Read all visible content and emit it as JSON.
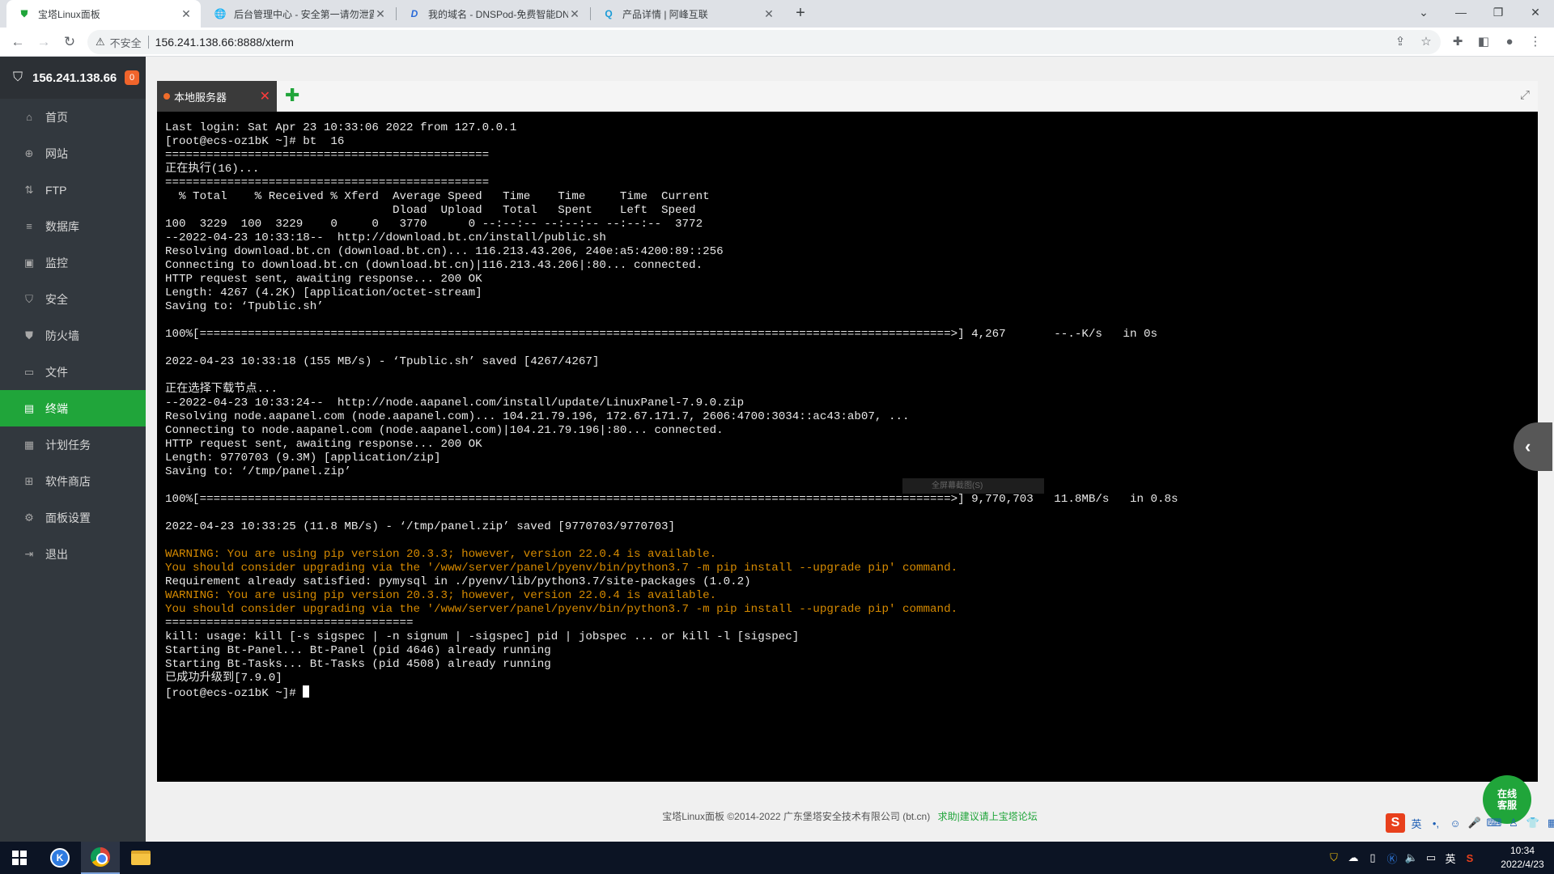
{
  "browser": {
    "tabs": [
      {
        "title": "宝塔Linux面板",
        "icon": "baota-shield-icon",
        "active": true
      },
      {
        "title": "后台管理中心 - 安全第一请勿泄露",
        "icon": "globe-icon",
        "active": false
      },
      {
        "title": "我的域名 - DNSPod-免费智能DNS",
        "icon": "dnspod-icon",
        "active": false
      },
      {
        "title": "产品详情 | 阿峰互联",
        "icon": "search-q-icon",
        "active": false
      }
    ],
    "new_tab": "+",
    "security_label": "不安全",
    "url": "156.241.138.66:8888/xterm",
    "win_controls": {
      "dropdown": "⌄",
      "minimize": "—",
      "restore": "❐",
      "close": "✕"
    }
  },
  "sidebar": {
    "server_ip": "156.241.138.66",
    "notification_count": "0",
    "items": [
      {
        "label": "首页",
        "icon": "home-icon",
        "glyph": "⌂"
      },
      {
        "label": "网站",
        "icon": "globe-icon",
        "glyph": "⊕"
      },
      {
        "label": "FTP",
        "icon": "ftp-icon",
        "glyph": "⇅"
      },
      {
        "label": "数据库",
        "icon": "database-icon",
        "glyph": "≡"
      },
      {
        "label": "监控",
        "icon": "monitor-icon",
        "glyph": "▣"
      },
      {
        "label": "安全",
        "icon": "shield-check-icon",
        "glyph": "⛉"
      },
      {
        "label": "防火墙",
        "icon": "firewall-icon",
        "glyph": "⛊"
      },
      {
        "label": "文件",
        "icon": "folder-icon",
        "glyph": "▭"
      },
      {
        "label": "终端",
        "icon": "terminal-icon",
        "glyph": "▤",
        "active": true
      },
      {
        "label": "计划任务",
        "icon": "calendar-icon",
        "glyph": "▦"
      },
      {
        "label": "软件商店",
        "icon": "apps-grid-icon",
        "glyph": "⊞"
      },
      {
        "label": "面板设置",
        "icon": "gear-icon",
        "glyph": "⚙"
      },
      {
        "label": "退出",
        "icon": "logout-icon",
        "glyph": "⇥"
      }
    ]
  },
  "terminal": {
    "tab_label": "本地服务器",
    "lines": [
      {
        "t": "Last login: Sat Apr 23 10:33:06 2022 from 127.0.0.1"
      },
      {
        "t": "[root@ecs-oz1bK ~]# bt  16"
      },
      {
        "t": "==============================================="
      },
      {
        "t": "正在执行(16)..."
      },
      {
        "t": "==============================================="
      },
      {
        "t": "  % Total    % Received % Xferd  Average Speed   Time    Time     Time  Current"
      },
      {
        "t": "                                 Dload  Upload   Total   Spent    Left  Speed"
      },
      {
        "t": "100  3229  100  3229    0     0   3770      0 --:--:-- --:--:-- --:--:--  3772"
      },
      {
        "t": "--2022-04-23 10:33:18--  http://download.bt.cn/install/public.sh"
      },
      {
        "t": "Resolving download.bt.cn (download.bt.cn)... 116.213.43.206, 240e:a5:4200:89::256"
      },
      {
        "t": "Connecting to download.bt.cn (download.bt.cn)|116.213.43.206|:80... connected."
      },
      {
        "t": "HTTP request sent, awaiting response... 200 OK"
      },
      {
        "t": "Length: 4267 (4.2K) [application/octet-stream]"
      },
      {
        "t": "Saving to: ‘Tpublic.sh’"
      },
      {
        "t": ""
      },
      {
        "t": "100%[=============================================================================================================>] 4,267       --.-K/s   in 0s"
      },
      {
        "t": ""
      },
      {
        "t": "2022-04-23 10:33:18 (155 MB/s) - ‘Tpublic.sh’ saved [4267/4267]"
      },
      {
        "t": ""
      },
      {
        "t": "正在选择下载节点..."
      },
      {
        "t": "--2022-04-23 10:33:24--  http://node.aapanel.com/install/update/LinuxPanel-7.9.0.zip"
      },
      {
        "t": "Resolving node.aapanel.com (node.aapanel.com)... 104.21.79.196, 172.67.171.7, 2606:4700:3034::ac43:ab07, ..."
      },
      {
        "t": "Connecting to node.aapanel.com (node.aapanel.com)|104.21.79.196|:80... connected."
      },
      {
        "t": "HTTP request sent, awaiting response... 200 OK"
      },
      {
        "t": "Length: 9770703 (9.3M) [application/zip]"
      },
      {
        "t": "Saving to: ‘/tmp/panel.zip’"
      },
      {
        "t": ""
      },
      {
        "t": "100%[=============================================================================================================>] 9,770,703   11.8MB/s   in 0.8s"
      },
      {
        "t": ""
      },
      {
        "t": "2022-04-23 10:33:25 (11.8 MB/s) - ‘/tmp/panel.zip’ saved [9770703/9770703]"
      },
      {
        "t": ""
      },
      {
        "t": "WARNING: You are using pip version 20.3.3; however, version 22.0.4 is available.",
        "warn": true
      },
      {
        "t": "You should consider upgrading via the '/www/server/panel/pyenv/bin/python3.7 -m pip install --upgrade pip' command.",
        "warn": true
      },
      {
        "t": "Requirement already satisfied: pymysql in ./pyenv/lib/python3.7/site-packages (1.0.2)"
      },
      {
        "t": "WARNING: You are using pip version 20.3.3; however, version 22.0.4 is available.",
        "warn": true
      },
      {
        "t": "You should consider upgrading via the '/www/server/panel/pyenv/bin/python3.7 -m pip install --upgrade pip' command.",
        "warn": true
      },
      {
        "t": "===================================="
      },
      {
        "t": "kill: usage: kill [-s sigspec | -n signum | -sigspec] pid | jobspec ... or kill -l [sigspec]"
      },
      {
        "t": "Starting Bt-Panel... Bt-Panel (pid 4646) already running"
      },
      {
        "t": "Starting Bt-Tasks... Bt-Tasks (pid 4508) already running"
      },
      {
        "t": "已成功升级到[7.9.0]"
      },
      {
        "t": "[root@ecs-oz1bK ~]# ",
        "cursor": true
      }
    ],
    "ghost_tooltip": "全屏幕截图(S)"
  },
  "footer": {
    "copyright": "宝塔Linux面板 ©2014-2022 广东堡塔安全技术有限公司 (bt.cn)",
    "link": "求助|建议请上宝塔论坛"
  },
  "support_button": {
    "line1": "在线",
    "line2": "客服"
  },
  "ime_bar": [
    "S",
    "英",
    "•,",
    "☺",
    "🎤",
    "⌨",
    "♙",
    "👕",
    "▦"
  ],
  "taskbar": {
    "clock_time": "10:34",
    "clock_date": "2022/4/23",
    "tray_lang": "英"
  },
  "colors": {
    "accent_green": "#20a53a",
    "sidebar_bg": "#32383e",
    "warning_text": "#d68a00",
    "badge": "#f0642b"
  }
}
